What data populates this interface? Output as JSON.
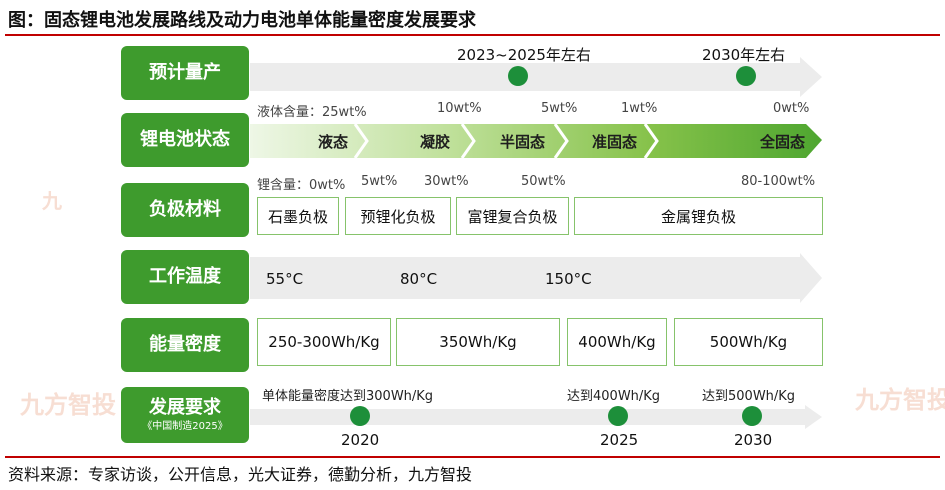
{
  "title": "图：固态锂电池发展路线及动力电池单体能量密度发展要求",
  "source": "资料来源：专家访谈，公开信息，光大证券，德勤分析，九方智投",
  "watermark": "九方智投",
  "colors": {
    "green": "#3e9b2d",
    "dark_green": "#1d8f3a",
    "red_rule": "#c00000",
    "grey_arrow": "#ececec"
  },
  "rows": {
    "mass_production": {
      "label": "预计量产",
      "milestones": [
        "2023~2025年左右",
        "2030年左右"
      ]
    },
    "battery_state": {
      "label": "锂电池状态",
      "liquid_prefix": "液体含量：",
      "liquid_values": [
        "25wt%",
        "10wt%",
        "5wt%",
        "1wt%",
        "0wt%"
      ],
      "stages": [
        "液态",
        "凝胶",
        "半固态",
        "准固态",
        "全固态"
      ]
    },
    "anode": {
      "label": "负极材料",
      "lithium_prefix": "锂含量：",
      "lithium_values": [
        "0wt%",
        "5wt%",
        "30wt%",
        "50wt%",
        "80-100wt%"
      ],
      "materials": [
        "石墨负极",
        "预锂化负极",
        "富锂复合负极",
        "金属锂负极"
      ]
    },
    "temperature": {
      "label": "工作温度",
      "values": [
        "55°C",
        "80°C",
        "150°C"
      ]
    },
    "energy_density": {
      "label": "能量密度",
      "values": [
        "250-300Wh/Kg",
        "350Wh/Kg",
        "400Wh/Kg",
        "500Wh/Kg"
      ]
    },
    "requirements": {
      "label": "发展要求",
      "sublabel": "《中国制造2025》",
      "targets": [
        "单体能量密度达到300Wh/Kg",
        "达到400Wh/Kg",
        "达到500Wh/Kg"
      ],
      "years": [
        "2020",
        "2025",
        "2030"
      ]
    }
  }
}
